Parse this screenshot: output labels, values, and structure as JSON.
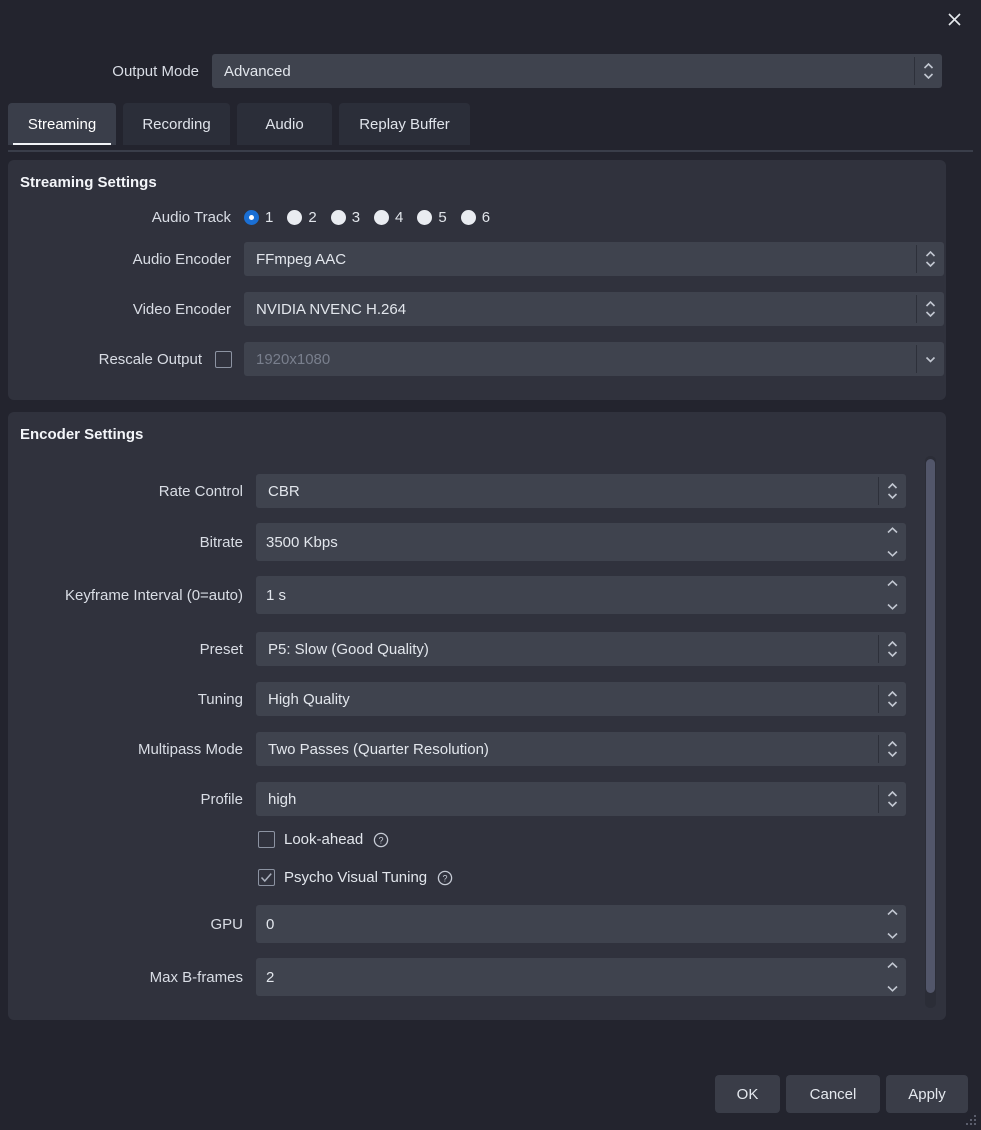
{
  "window": {
    "close_label": "×",
    "close_icon": "close-icon"
  },
  "output_mode": {
    "label": "Output Mode",
    "value": "Advanced"
  },
  "tabs": [
    {
      "label": "Streaming",
      "active": true
    },
    {
      "label": "Recording",
      "active": false
    },
    {
      "label": "Audio",
      "active": false
    },
    {
      "label": "Replay Buffer",
      "active": false
    }
  ],
  "streaming_settings": {
    "title": "Streaming Settings",
    "audio_track": {
      "label": "Audio Track",
      "options": [
        "1",
        "2",
        "3",
        "4",
        "5",
        "6"
      ],
      "selected": "1"
    },
    "audio_encoder": {
      "label": "Audio Encoder",
      "value": "FFmpeg AAC"
    },
    "video_encoder": {
      "label": "Video Encoder",
      "value": "NVIDIA NVENC H.264"
    },
    "rescale_output": {
      "label": "Rescale Output",
      "checked": false,
      "value": "1920x1080",
      "placeholder": "1920x1080"
    }
  },
  "encoder_settings": {
    "title": "Encoder Settings",
    "rate_control": {
      "label": "Rate Control",
      "value": "CBR"
    },
    "bitrate": {
      "label": "Bitrate",
      "value": "3500 Kbps"
    },
    "keyframe_interval": {
      "label": "Keyframe Interval (0=auto)",
      "value": "1 s"
    },
    "preset": {
      "label": "Preset",
      "value": "P5: Slow (Good Quality)"
    },
    "tuning": {
      "label": "Tuning",
      "value": "High Quality"
    },
    "multipass_mode": {
      "label": "Multipass Mode",
      "value": "Two Passes (Quarter Resolution)"
    },
    "profile": {
      "label": "Profile",
      "value": "high"
    },
    "look_ahead": {
      "label": "Look-ahead",
      "checked": false,
      "help": "?"
    },
    "psycho_visual_tuning": {
      "label": "Psycho Visual Tuning",
      "checked": true,
      "help": "?"
    },
    "gpu": {
      "label": "GPU",
      "value": "0"
    },
    "max_b_frames": {
      "label": "Max B-frames",
      "value": "2"
    }
  },
  "footer": {
    "ok": "OK",
    "cancel": "Cancel",
    "apply": "Apply"
  },
  "colors": {
    "dialog_bg": "#23242e",
    "panel_bg": "#30323d",
    "input_bg": "#3f434e",
    "accent": "#1a6fd4",
    "text": "#d8dce4",
    "tab_active_bg": "#3a3e4a"
  }
}
